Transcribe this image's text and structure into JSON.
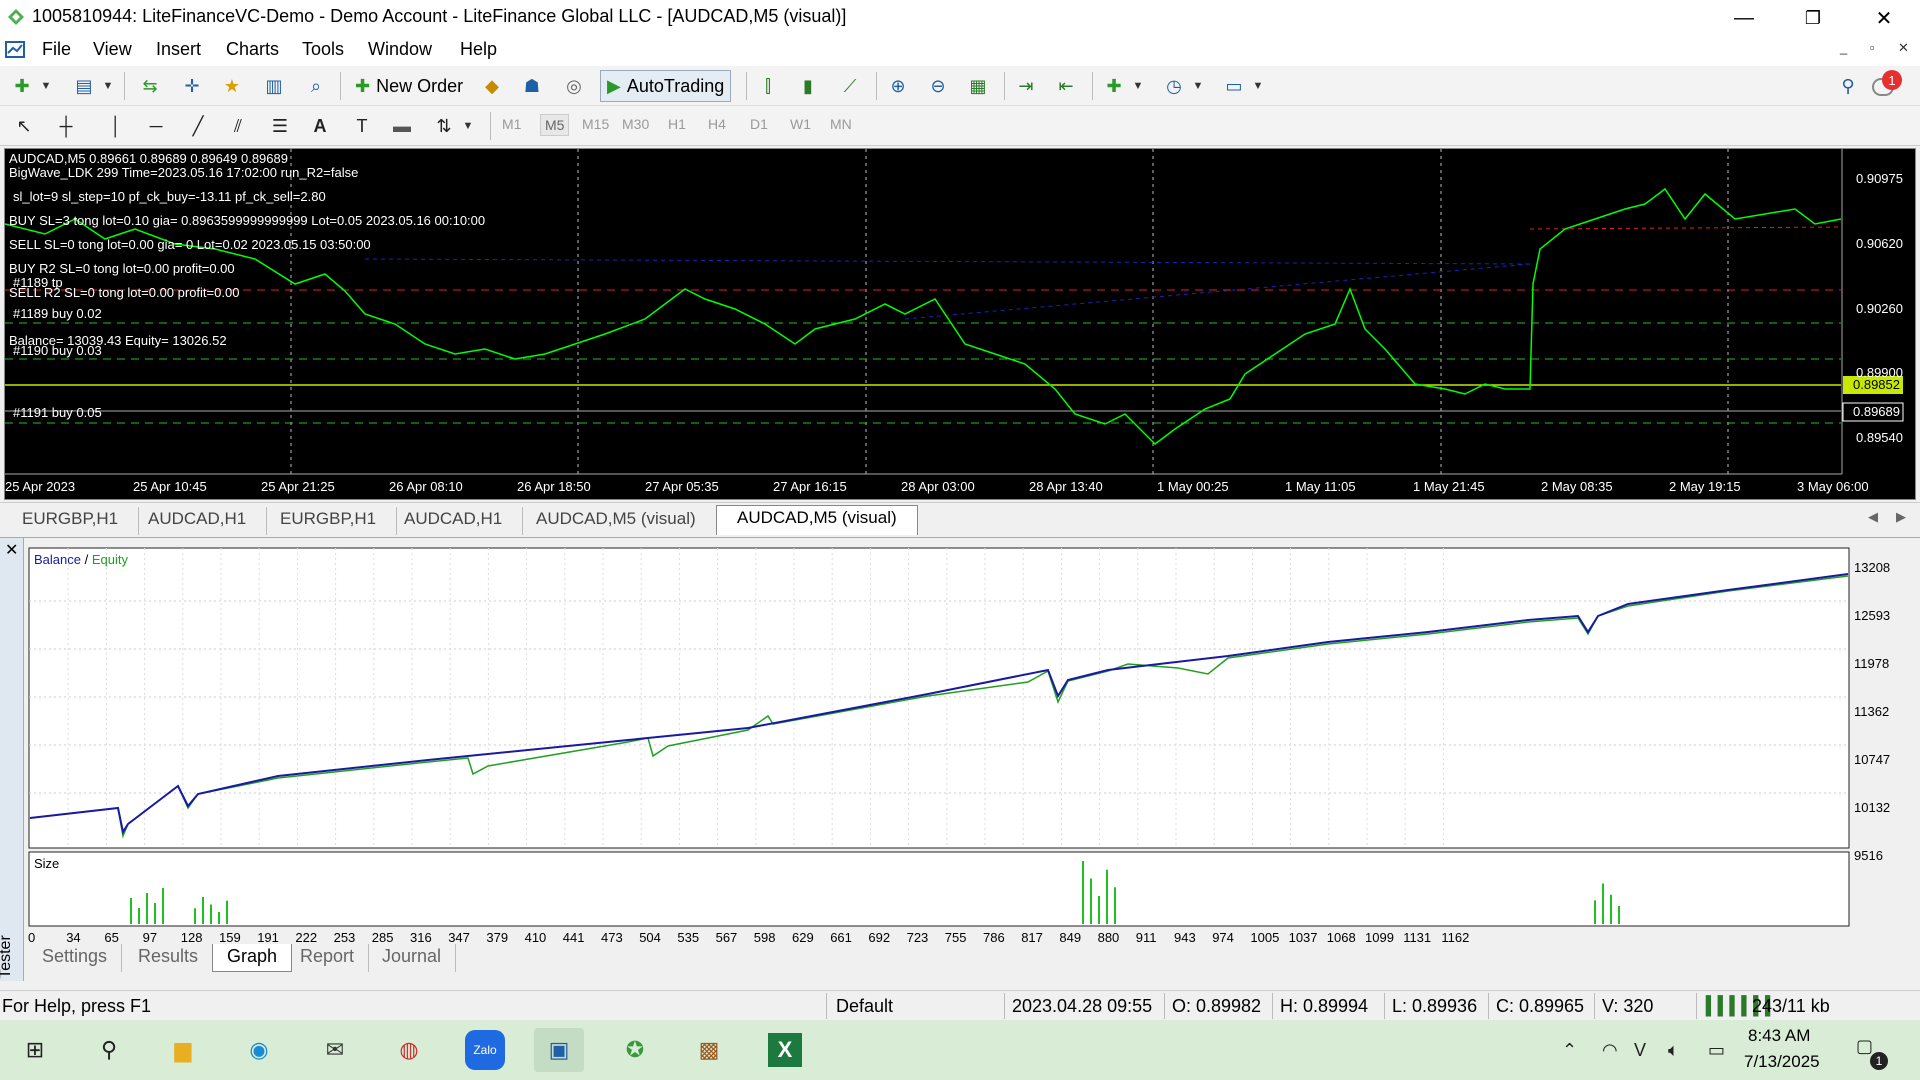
{
  "window": {
    "title": "1005810944: LiteFinanceVC-Demo - Demo Account - LiteFinance Global LLC - [AUDCAD,M5 (visual)]",
    "controls": {
      "minimize": "—",
      "restore": "❐",
      "close": "✕"
    }
  },
  "menu": [
    "File",
    "View",
    "Insert",
    "Charts",
    "Tools",
    "Window",
    "Help"
  ],
  "toolbar": {
    "new_order": "New Order",
    "autotrading": "AutoTrading",
    "notification_count": "1"
  },
  "timeframes": [
    "M1",
    "M5",
    "M15",
    "M30",
    "H1",
    "H4",
    "D1",
    "W1",
    "MN"
  ],
  "active_timeframe": "M5",
  "chart": {
    "header": "AUDCAD,M5  0.89661 0.89689 0.89649 0.89689",
    "ea_lines": [
      "BigWave_LDK 299   Time=2023.05.16 17:02:00   run_R2=false",
      "sl_lot=9  sl_step=10  pf_ck_buy=-13.11  pf_ck_sell=2.80",
      "BUY  SL=3 tong lot=0.10  gia= 0.8963599999999999 Lot=0.05  2023.05.16 00:10:00",
      "SELL  SL=0 tong lot=0.00 gia= 0 Lot=0.02  2023.05.15 03:50:00",
      "BUY R2  SL=0 tong lot=0.00 profit=0.00",
      "SELL R2  SL=0 tong lot=0.00 profit=0.00"
    ],
    "order_labels": [
      "#1189 tp",
      "#1189 buy 0.02",
      "#1190 buy 0.03",
      "#1191 buy 0.05"
    ],
    "balance_line": "Balance= 13039.43  Equity= 13026.52",
    "price_ticks": [
      "0.90975",
      "0.90620",
      "0.90260",
      "0.89900",
      "0.89540"
    ],
    "current_price": "0.89852",
    "secondary_price": "0.89689",
    "time_ticks": [
      "25 Apr 2023",
      "25 Apr 10:45",
      "25 Apr 21:25",
      "26 Apr 08:10",
      "26 Apr 18:50",
      "27 Apr 05:35",
      "27 Apr 16:15",
      "28 Apr 03:00",
      "28 Apr 13:40",
      "1 May 00:25",
      "1 May 11:05",
      "1 May 21:45",
      "2 May 08:35",
      "2 May 19:15",
      "3 May 06:00"
    ],
    "colors": {
      "price": "#00ff00",
      "bg": "#000000",
      "current_price_box": "#c8e800",
      "blue_line": "#2020c0"
    }
  },
  "chart_tabs": [
    "EURGBP,H1",
    "AUDCAD,H1",
    "EURGBP,H1",
    "AUDCAD,H1",
    "AUDCAD,M5 (visual)",
    "AUDCAD,M5 (visual)"
  ],
  "active_chart_tab": 5,
  "tester": {
    "side_label": "Tester",
    "legend_balance": "Balance",
    "legend_sep": " / ",
    "legend_equity": "Equity",
    "y_ticks": [
      "13208",
      "12593",
      "11978",
      "11362",
      "10747",
      "10132",
      "9516"
    ],
    "size_label": "Size",
    "x_ticks": [
      "0",
      "34",
      "65",
      "97",
      "128",
      "159",
      "191",
      "222",
      "253",
      "285",
      "316",
      "347",
      "379",
      "410",
      "441",
      "473",
      "504",
      "535",
      "567",
      "598",
      "629",
      "661",
      "692",
      "723",
      "755",
      "786",
      "817",
      "849",
      "880",
      "911",
      "943",
      "974",
      "1005",
      "1037",
      "1068",
      "1099",
      "1131",
      "1162"
    ],
    "tabs": [
      "Settings",
      "Results",
      "Graph",
      "Report",
      "Journal"
    ],
    "active_tab": 2,
    "colors": {
      "balance": "#1a1aa0",
      "equity": "#20a020",
      "size": "#20c020"
    }
  },
  "status": {
    "help": "For Help, press F1",
    "profile": "Default",
    "datetime": "2023.04.28 09:55",
    "open": "O: 0.89982",
    "high": "H: 0.89994",
    "low": "L: 0.89936",
    "close": "C: 0.89965",
    "volume": "V: 320",
    "traffic": "243/11 kb"
  },
  "taskbar": {
    "time": "8:43 AM",
    "date": "7/13/2025",
    "notif_count": "1",
    "apps": [
      "start-icon",
      "search-icon",
      "file-explorer-icon",
      "edge-icon",
      "mail-icon",
      "chrome-icon",
      "zalo-icon",
      "terminal-icon",
      "app-icon",
      "winrar-icon",
      "excel-icon"
    ],
    "zalo_label": "Zalo"
  }
}
